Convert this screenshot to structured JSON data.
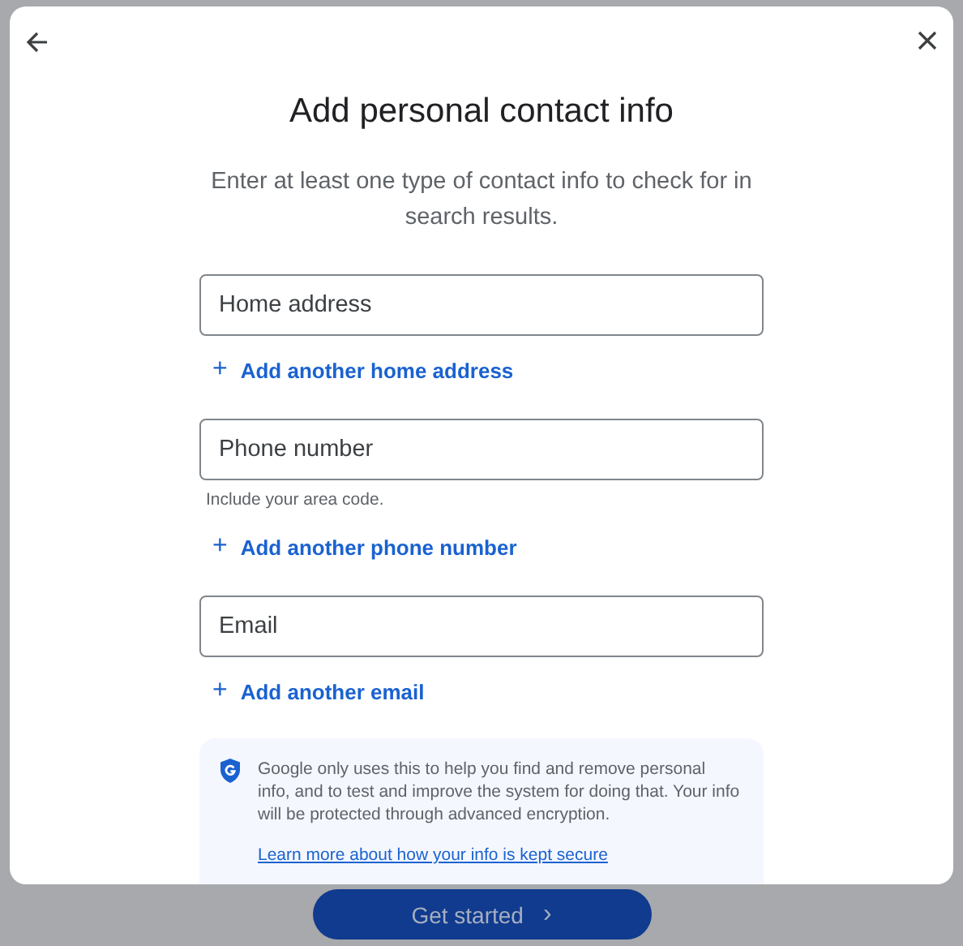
{
  "dialog": {
    "title": "Add personal contact info",
    "subtitle": "Enter at least one type of contact info to check for in search results.",
    "sections": [
      {
        "placeholder": "Home address",
        "add_link": "Add another home address"
      },
      {
        "placeholder": "Phone number",
        "hint": "Include your area code.",
        "add_link": "Add another phone number"
      },
      {
        "placeholder": "Email",
        "add_link": "Add another email"
      }
    ],
    "add_icon": "+",
    "notice": {
      "text": "Google only uses this to help you find and remove personal info, and to test and improve the system for doing that. Your info will be protected through advanced encryption.",
      "link": "Learn more about how your info is kept secure"
    }
  },
  "footer": {
    "button": "Get started",
    "button_icon": "›"
  }
}
